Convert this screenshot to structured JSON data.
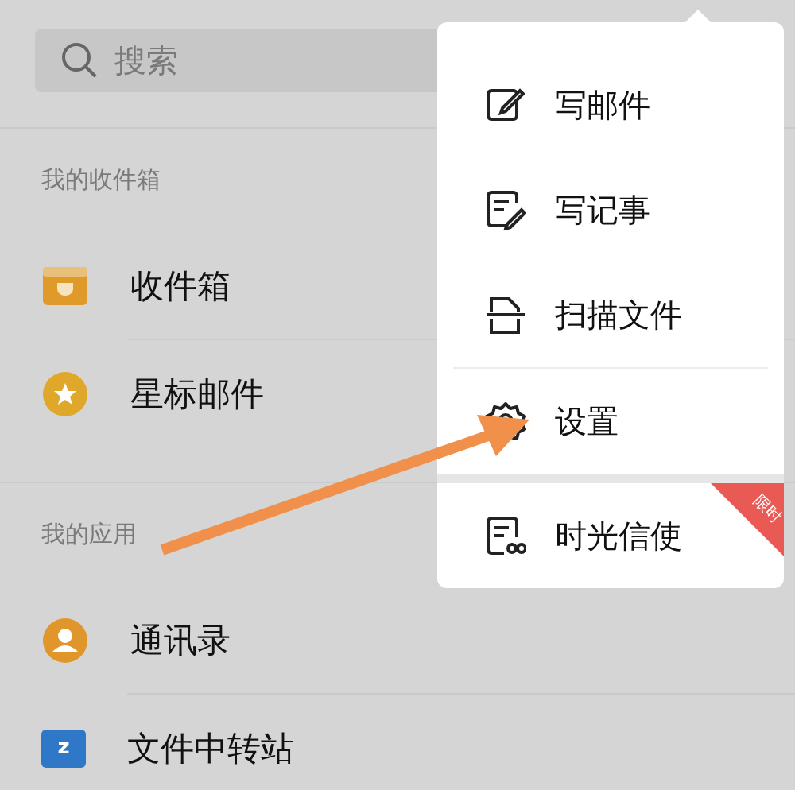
{
  "search": {
    "placeholder": "搜索"
  },
  "sections": [
    {
      "title": "我的收件箱",
      "items": [
        {
          "label": "收件箱",
          "kind": "inbox",
          "color": "#e09a2a"
        },
        {
          "label": "星标邮件",
          "kind": "star",
          "color": "#e0a82a"
        }
      ]
    },
    {
      "title": "我的应用",
      "items": [
        {
          "label": "通讯录",
          "kind": "contact",
          "color": "#e0962a"
        },
        {
          "label": "文件中转站",
          "kind": "folder",
          "color": "#2f78c8",
          "icon_label": "z"
        }
      ]
    }
  ],
  "menu": {
    "items": [
      {
        "label": "写邮件",
        "kind": "compose",
        "divider_above": false,
        "gap_above": false
      },
      {
        "label": "写记事",
        "kind": "note",
        "divider_above": false,
        "gap_above": false
      },
      {
        "label": "扫描文件",
        "kind": "scan",
        "divider_above": false,
        "gap_above": false
      },
      {
        "label": "设置",
        "kind": "settings",
        "divider_above": true,
        "gap_above": false
      },
      {
        "label": "时光信使",
        "kind": "letter",
        "divider_above": false,
        "gap_above": true,
        "badge": "限时"
      }
    ]
  },
  "annotation": {
    "kind": "arrow"
  }
}
